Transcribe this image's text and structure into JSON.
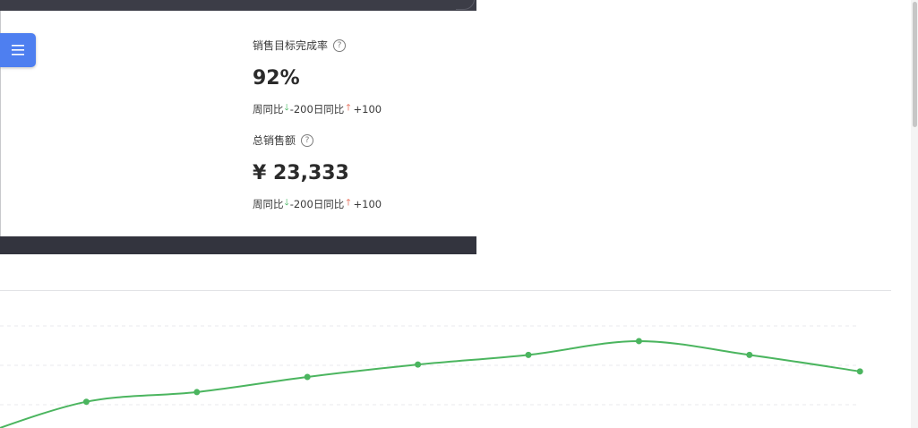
{
  "menu": {
    "icon": "menu-icon"
  },
  "metrics": [
    {
      "title": "销售目标完成率",
      "help_icon": "help-circle-icon",
      "value": "92%",
      "week_label": "周同比",
      "week_value": "-200",
      "day_label": "日同比",
      "day_value": "+100"
    },
    {
      "title": "总销售额",
      "help_icon": "help-circle-icon",
      "value": "¥ 23,333",
      "week_label": "周同比",
      "week_value": "-200",
      "day_label": "日同比",
      "day_value": "+100"
    }
  ],
  "colors": {
    "menu_button": "#4e7ff0",
    "line": "#4bb55f",
    "down_arrow": "#3fb25c",
    "up_arrow": "#e0492f"
  },
  "chart_data": {
    "type": "line",
    "y": [
      20,
      45,
      52,
      63,
      72,
      79,
      89,
      79,
      67
    ],
    "ylim": [
      0,
      100
    ],
    "grid": true,
    "smooth": true
  }
}
